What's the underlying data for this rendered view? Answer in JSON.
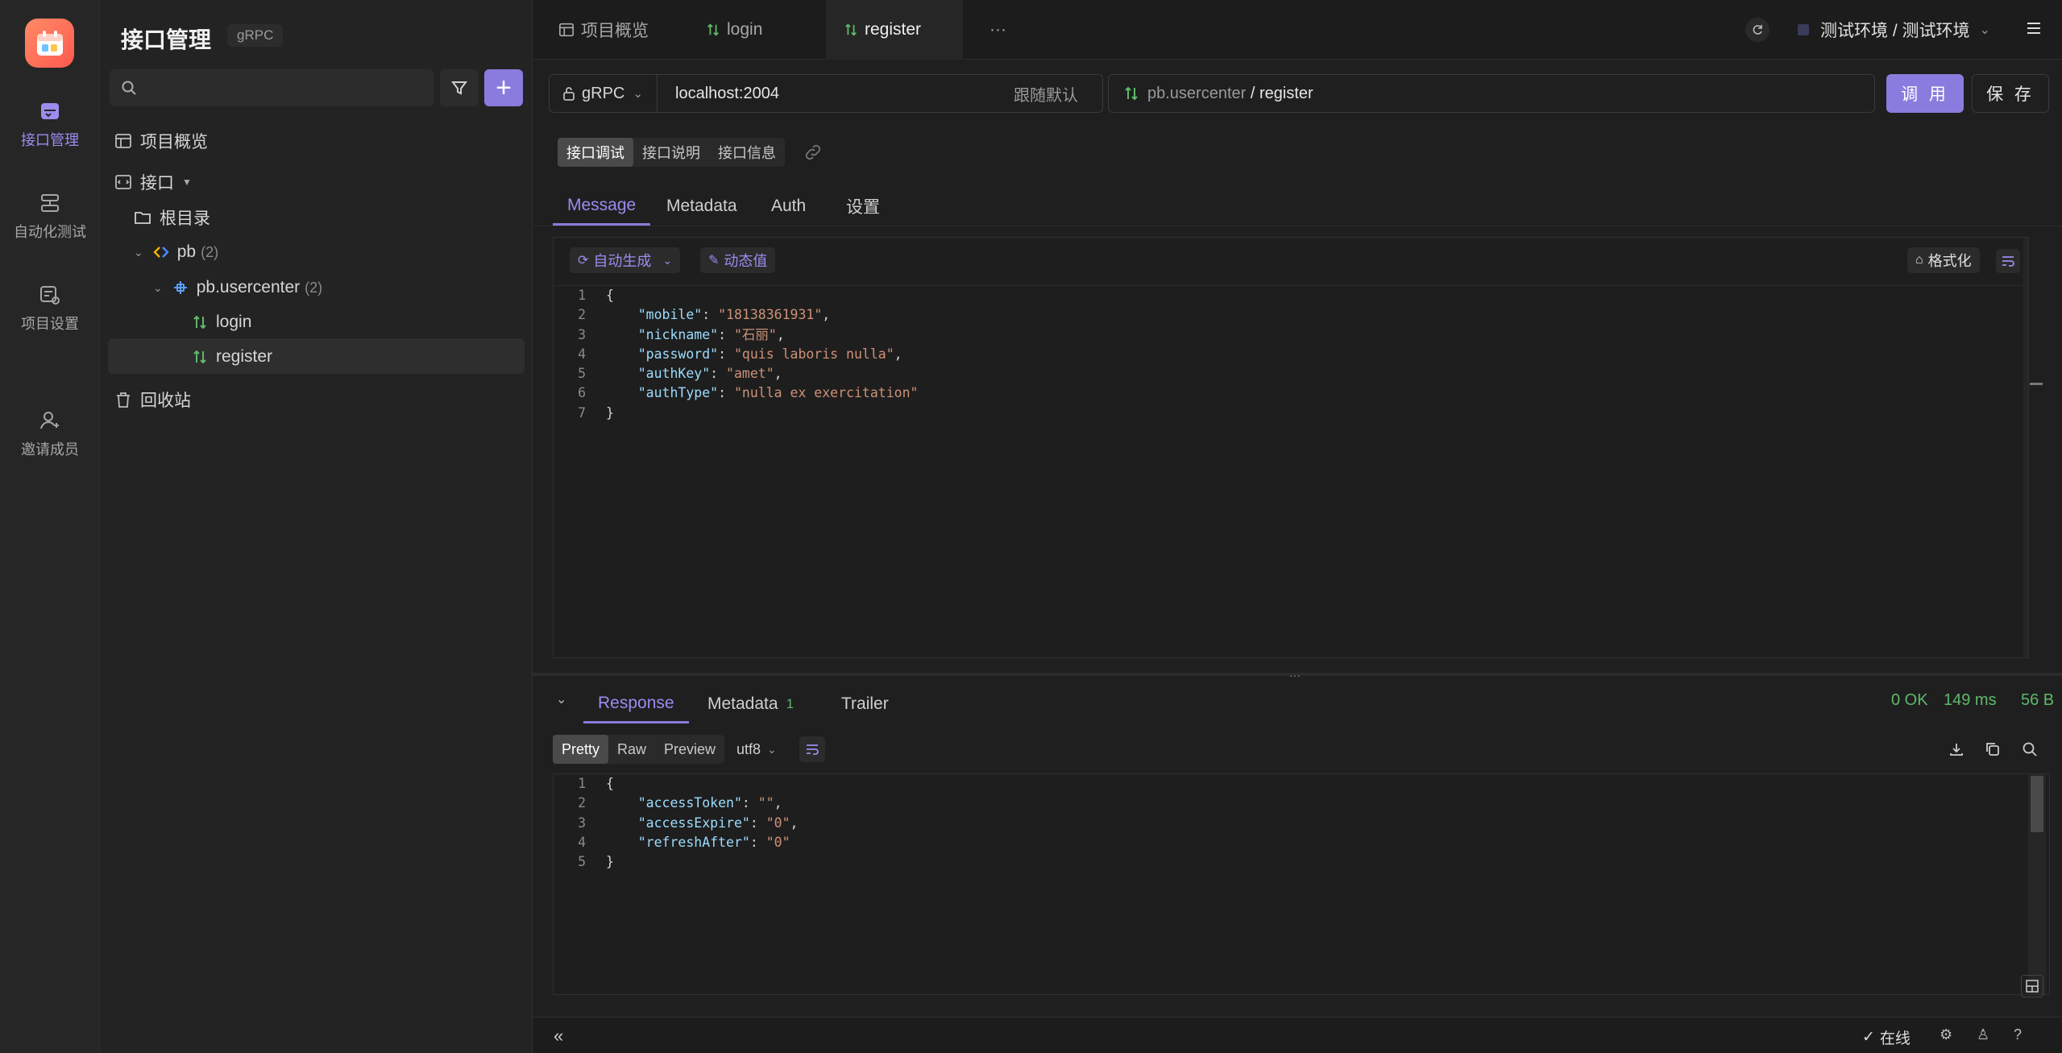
{
  "app": {
    "title": "接口管理",
    "protocol_tag": "gRPC"
  },
  "rail": {
    "items": [
      {
        "label": "接口管理"
      },
      {
        "label": "自动化测试"
      },
      {
        "label": "项目设置"
      },
      {
        "label": "邀请成员"
      }
    ]
  },
  "sidebar": {
    "search_placeholder": "",
    "overview": "项目概览",
    "interfaces_label": "接口",
    "root_label": "根目录",
    "pb_label": "pb",
    "pb_count": "(2)",
    "service_label": "pb.usercenter",
    "service_count": "(2)",
    "methods": [
      "login",
      "register"
    ],
    "recycle": "回收站"
  },
  "tabs": {
    "overview": "项目概览",
    "login": "login",
    "register": "register",
    "more": "···",
    "env": "测试环境 / 测试环境"
  },
  "request": {
    "protocol": "gRPC",
    "host": "localhost:2004",
    "host_hint": "跟随默认",
    "service": "pb.usercenter",
    "separator": " / ",
    "method": "register",
    "invoke_label": "调 用",
    "save_label": "保 存"
  },
  "mode_tabs": [
    "接口调试",
    "接口说明",
    "接口信息"
  ],
  "req_tabs": [
    "Message",
    "Metadata",
    "Auth",
    "设置"
  ],
  "editor_toolbar": {
    "auto_gen": "自动生成",
    "dynamic": "动态值",
    "format": "格式化"
  },
  "request_body": [
    {
      "n": "1",
      "text": "{"
    },
    {
      "n": "2",
      "key": "\"mobile\"",
      "val": "\"18138361931\"",
      "end": ","
    },
    {
      "n": "3",
      "key": "\"nickname\"",
      "val": "\"石丽\"",
      "end": ","
    },
    {
      "n": "4",
      "key": "\"password\"",
      "val": "\"quis laboris nulla\"",
      "end": ","
    },
    {
      "n": "5",
      "key": "\"authKey\"",
      "val": "\"amet\"",
      "end": ","
    },
    {
      "n": "6",
      "key": "\"authType\"",
      "val": "\"nulla ex exercitation\"",
      "end": ""
    },
    {
      "n": "7",
      "text": "}"
    }
  ],
  "response": {
    "tabs": [
      "Response",
      "Metadata",
      "Trailer"
    ],
    "metadata_count": "1",
    "status": "0 OK",
    "time": "149 ms",
    "size": "56 B",
    "view_modes": [
      "Pretty",
      "Raw",
      "Preview"
    ],
    "encoding": "utf8",
    "body": [
      {
        "n": "1",
        "text": "{"
      },
      {
        "n": "2",
        "key": "\"accessToken\"",
        "val": "\"\"",
        "end": ","
      },
      {
        "n": "3",
        "key": "\"accessExpire\"",
        "val": "\"0\"",
        "end": ","
      },
      {
        "n": "4",
        "key": "\"refreshAfter\"",
        "val": "\"0\"",
        "end": ""
      },
      {
        "n": "5",
        "text": "}"
      }
    ]
  },
  "footer": {
    "online": "在线"
  },
  "colors": {
    "accent": "#8a7cde",
    "ok": "#5fb86b"
  }
}
